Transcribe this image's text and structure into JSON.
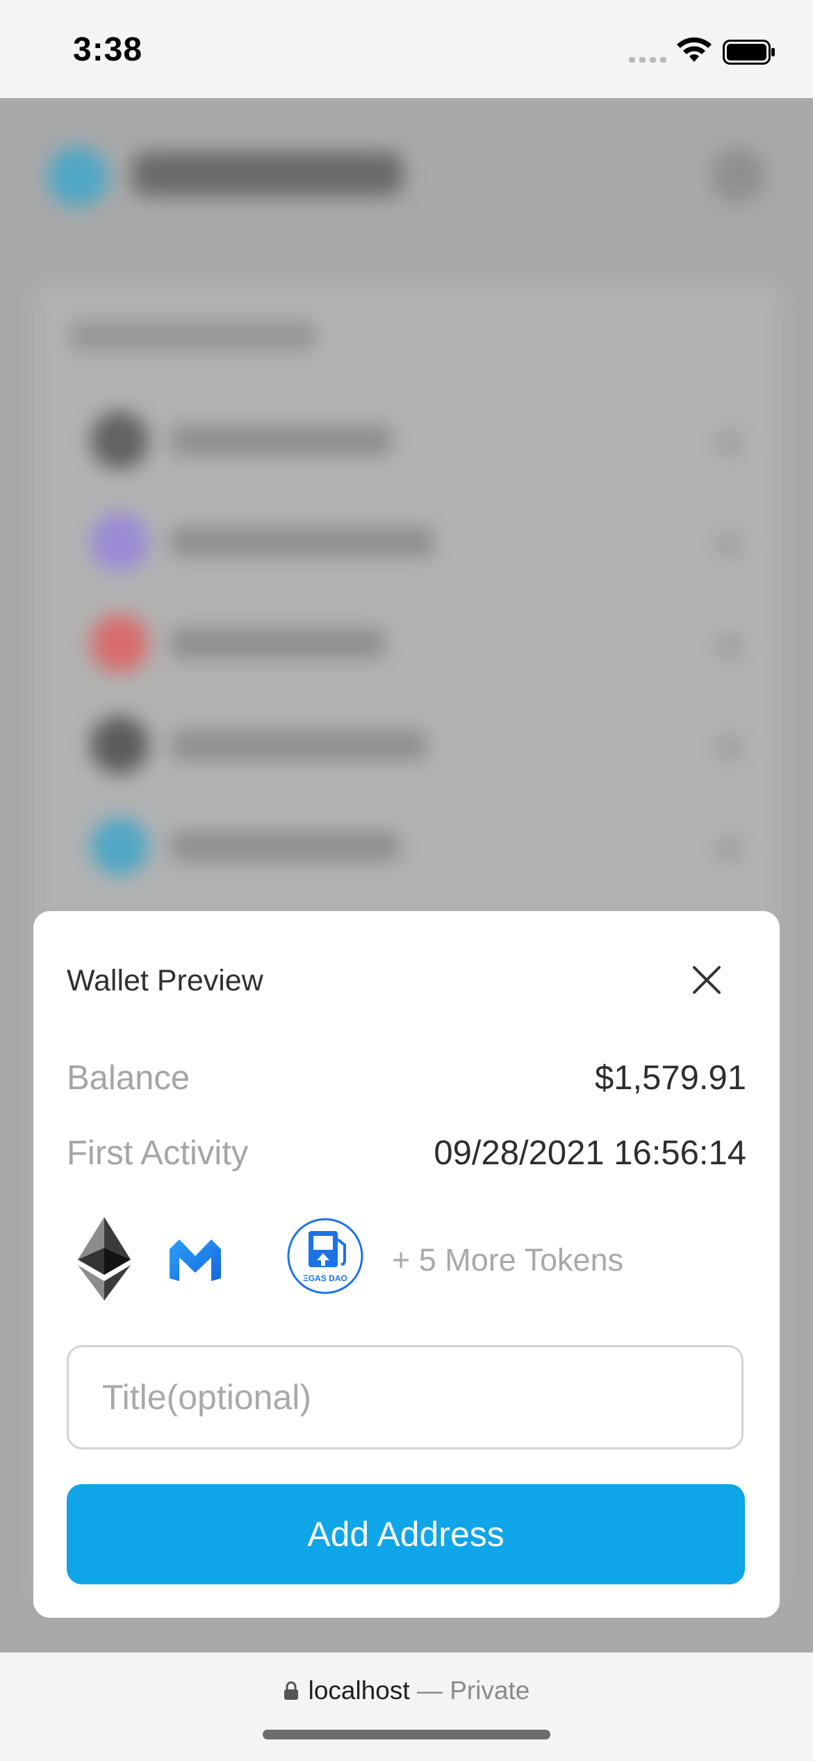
{
  "status_bar": {
    "time": "3:38",
    "icons": [
      "signal-icon",
      "wifi-icon",
      "battery-icon"
    ]
  },
  "modal": {
    "title": "Wallet Preview",
    "balance_label": "Balance",
    "balance_value": "$1,579.91",
    "first_activity_label": "First Activity",
    "first_activity_value": "09/28/2021 16:56:14",
    "tokens": [
      {
        "name": "ethereum-icon"
      },
      {
        "name": "matic-icon"
      },
      {
        "name": "gas-dao-icon",
        "label": "ΞGAS DAO"
      }
    ],
    "more_tokens": "+ 5 More Tokens",
    "title_placeholder": "Title(optional)",
    "title_value": "",
    "add_button": "Add Address"
  },
  "browser": {
    "host": "localhost",
    "mode": "— Private"
  },
  "colors": {
    "accent": "#0ea5e9",
    "overlay": "#a9a9a9",
    "gas_dao": "#1a73e8"
  }
}
